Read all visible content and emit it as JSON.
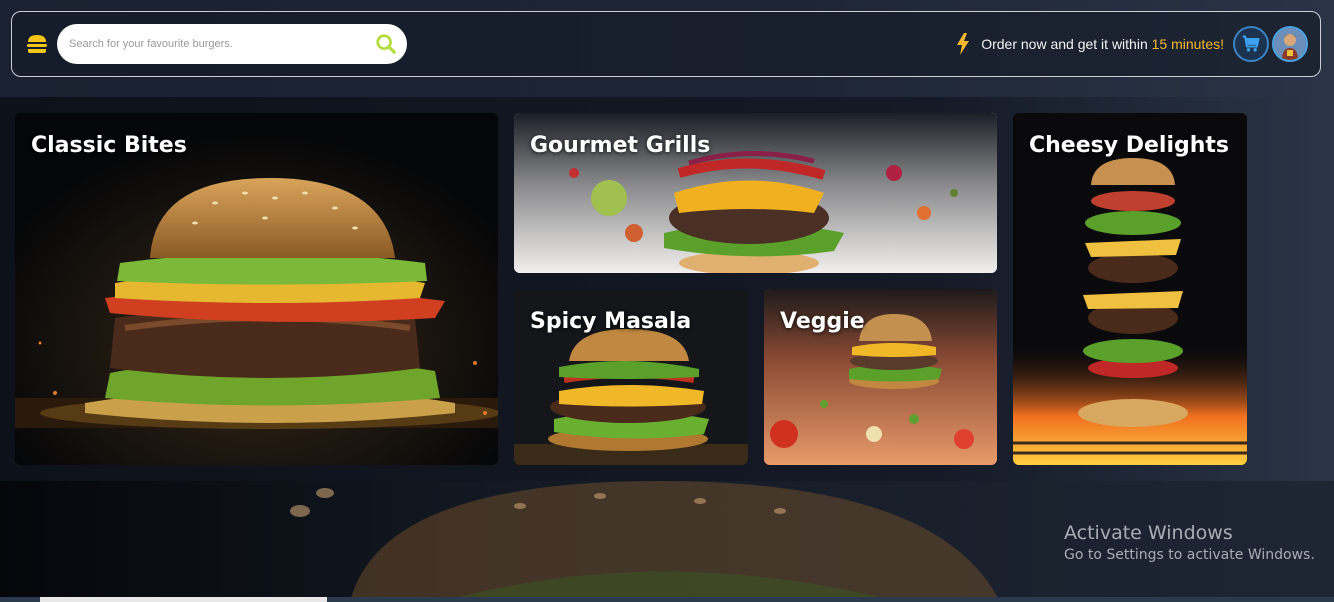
{
  "header": {
    "search_placeholder": "Search for your favourite burgers.",
    "order_text": "Order now and get it within ",
    "order_highlight": "15 minutes!",
    "logo_icon": "burger-icon",
    "search_icon": "search-icon",
    "bolt_icon": "lightning-icon",
    "cart_icon": "cart-icon",
    "avatar_icon": "user-avatar",
    "accent": "#f5b82e",
    "search_accent": "#b4dc3c"
  },
  "categories": [
    {
      "label": "Classic Bites"
    },
    {
      "label": "Gourmet Grills"
    },
    {
      "label": "Spicy Masala"
    },
    {
      "label": "Veggie"
    },
    {
      "label": "Cheesy Delights"
    }
  ],
  "watermark": {
    "title": "Activate Windows",
    "subtitle": "Go to Settings to activate Windows."
  }
}
